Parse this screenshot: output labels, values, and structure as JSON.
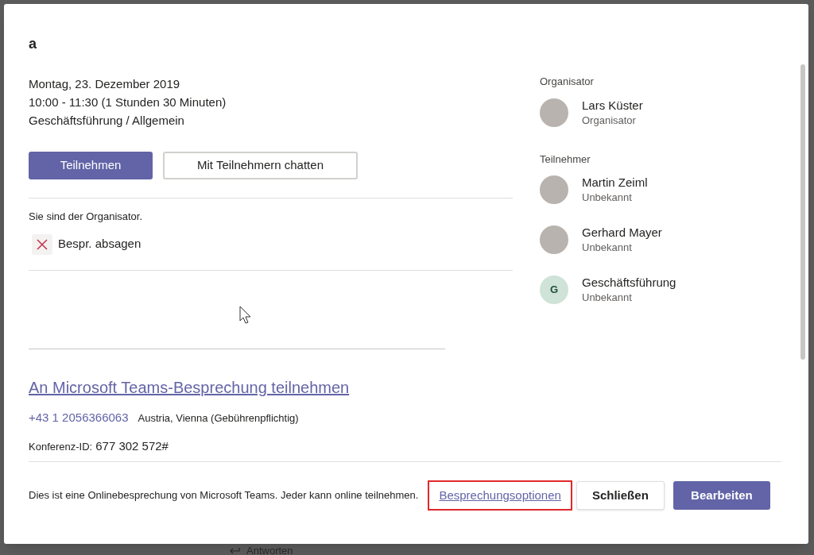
{
  "background": {
    "reply_label": "Antworten"
  },
  "dialog": {
    "title": "a",
    "details": [
      "Montag, 23. Dezember 2019",
      "10:00 - 11:30 (1 Stunden 30 Minuten)",
      "Geschäftsführung / Allgemein"
    ],
    "join_button": "Teilnehmen",
    "chat_button": "Mit Teilnehmern chatten",
    "organizer_note": "Sie sind der Organisator.",
    "cancel_action": "Bespr. absagen",
    "join_link": "An Microsoft Teams-Besprechung teilnehmen",
    "phone": "+43 1 2056366063",
    "phone_location": "Austria, Vienna (Gebührenpflichtig)",
    "conference_id_label": "Konferenz-ID:",
    "conference_id": "677 302 572#",
    "organizer_heading": "Organisator",
    "organizer": {
      "name": "Lars Küster",
      "role": "Organisator",
      "kind": "photo"
    },
    "attendees_heading": "Teilnehmer",
    "attendees": [
      {
        "name": "Martin Zeiml",
        "role": "Unbekannt",
        "kind": "photo"
      },
      {
        "name": "Gerhard Mayer",
        "role": "Unbekannt",
        "kind": "photo"
      },
      {
        "name": "Geschäftsführung",
        "role": "Unbekannt",
        "kind": "initial",
        "initial": "G",
        "color": "#cfe3d8"
      }
    ],
    "footer_note": "Dies ist eine Onlinebesprechung von Microsoft Teams. Jeder kann online teilnehmen.",
    "options_link": "Besprechungsoptionen",
    "options_link_highlighted": true,
    "close_button": "Schließen",
    "edit_button": "Bearbeiten"
  }
}
